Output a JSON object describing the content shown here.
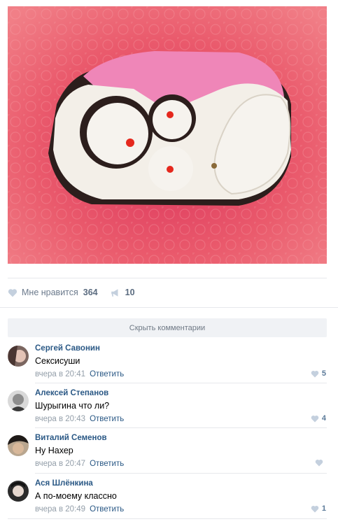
{
  "post": {
    "likes_label": "Мне нравится",
    "likes_count": "364",
    "shares_count": "10",
    "hide_comments": "Скрыть комментарии"
  },
  "comments": [
    {
      "author": "Сергей Савонин",
      "text": "Сексисуши",
      "time": "вчера в 20:41",
      "reply": "Ответить",
      "likes": "5"
    },
    {
      "author": "Алексей Степанов",
      "text": "Шурыгина что ли?",
      "time": "вчера в 20:43",
      "reply": "Ответить",
      "likes": "4"
    },
    {
      "author": "Виталий Семенов",
      "text": "Ну Нахер",
      "time": "вчера в 20:47",
      "reply": "Ответить",
      "likes": ""
    },
    {
      "author": "Ася Шлёнкина",
      "text": "А по-моему классно",
      "time": "вчера в 20:49",
      "reply": "Ответить",
      "likes": "1"
    }
  ],
  "colors": {
    "link": "#2a5885",
    "muted": "#939ea9",
    "separator": "#e7e8ec"
  }
}
